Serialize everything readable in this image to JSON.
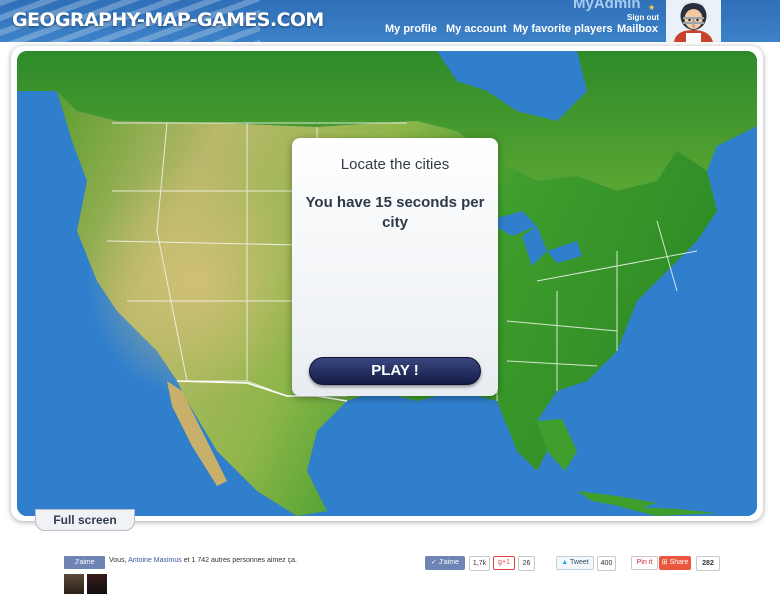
{
  "header": {
    "site_title": "GEOGRAPHY-MAP-GAMES.COM",
    "username": "MyAdmin",
    "sign_out": "Sign out",
    "nav": [
      "My profile",
      "My account",
      "My favorite players",
      "Mailbox"
    ]
  },
  "dialog": {
    "title": "Locate the cities",
    "message": "You have 15 seconds per city",
    "play": "PLAY !"
  },
  "fullscreen_label": "Full screen",
  "social": {
    "fb_like": "J'aime",
    "like_prefix": "Vous, ",
    "like_name": "Antoine Maximus",
    "like_suffix": " et 1 742 autres personnes aimez ça.",
    "fb_like_small": "J'aime",
    "fb_count": "1,7k",
    "gplus": "+1",
    "gplus_count": "26",
    "tweet": "Tweet",
    "tweet_count": "400",
    "pinit": "Pin it",
    "share": "Share",
    "share_count": "282"
  },
  "colors": {
    "header": "#3c82c8",
    "ocean": "#2f7fcd",
    "land": "#3f9e2c",
    "desert": "#c9c072",
    "play_button": "#1c2550",
    "facebook": "#6d84b4"
  }
}
